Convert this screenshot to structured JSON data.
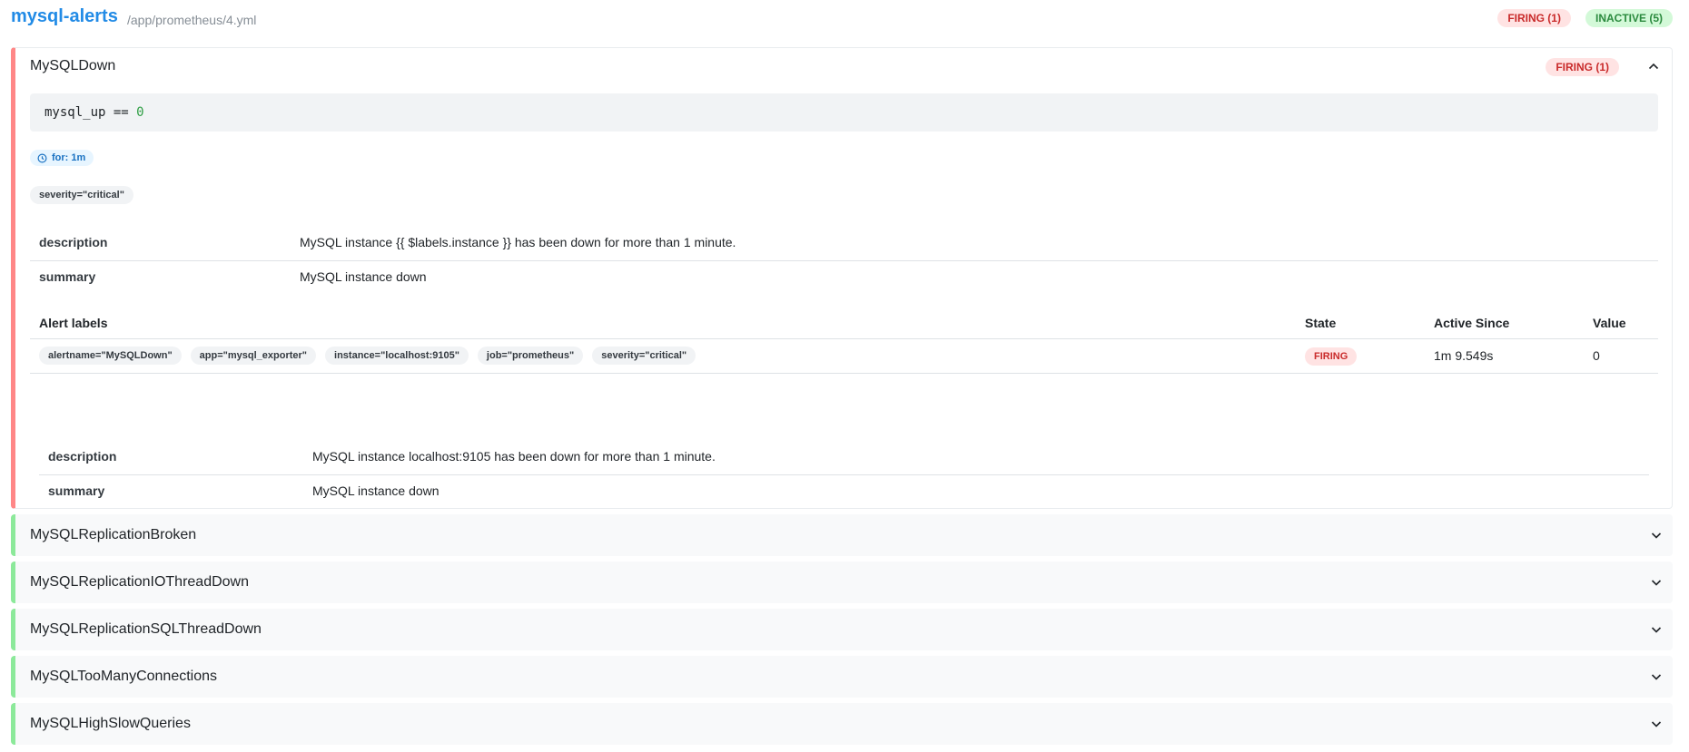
{
  "group": {
    "name": "mysql-alerts",
    "file": "/app/prometheus/4.yml",
    "firing_badge": "FIRING (1)",
    "inactive_badge": "INACTIVE (5)"
  },
  "expanded_rule": {
    "name": "MySQLDown",
    "badge": "FIRING (1)",
    "expr_text": "mysql_up == ",
    "expr_value": "0",
    "for": "for: 1m",
    "labels": [
      "severity=\"critical\""
    ],
    "annotations": [
      {
        "key": "description",
        "value": "MySQL instance {{ $labels.instance }} has been down for more than 1 minute."
      },
      {
        "key": "summary",
        "value": "MySQL instance down"
      }
    ],
    "alerts_table": {
      "headers": {
        "labels": "Alert labels",
        "state": "State",
        "active_since": "Active Since",
        "value": "Value"
      },
      "rows": [
        {
          "labels": [
            "alertname=\"MySQLDown\"",
            "app=\"mysql_exporter\"",
            "instance=\"localhost:9105\"",
            "job=\"prometheus\"",
            "severity=\"critical\""
          ],
          "state": "FIRING",
          "active_since": "1m 9.549s",
          "value": "0"
        }
      ],
      "annotations": [
        {
          "key": "description",
          "value": "MySQL instance localhost:9105 has been down for more than 1 minute."
        },
        {
          "key": "summary",
          "value": "MySQL instance down"
        }
      ]
    }
  },
  "collapsed_rules": [
    {
      "name": "MySQLReplicationBroken"
    },
    {
      "name": "MySQLReplicationIOThreadDown"
    },
    {
      "name": "MySQLReplicationSQLThreadDown"
    },
    {
      "name": "MySQLTooManyConnections"
    },
    {
      "name": "MySQLHighSlowQueries"
    }
  ],
  "colors": {
    "accent": "#228be6",
    "firing": "#ff8787",
    "inactive": "#8ce99a"
  }
}
